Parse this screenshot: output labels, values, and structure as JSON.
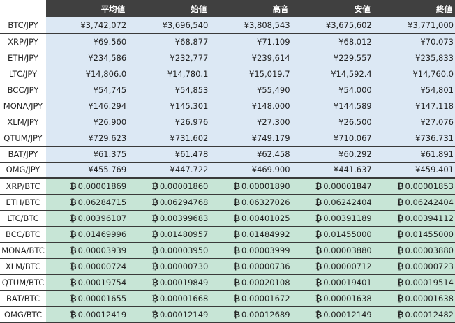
{
  "headers": [
    "",
    "平均値",
    "始値",
    "高音",
    "安値",
    "終値"
  ],
  "symbols": {
    "yen": "¥",
    "btc": "₿"
  },
  "colors": {
    "header_bg": "#404040",
    "jpy_row_bg": "#dce8f4",
    "btc_row_bg": "#c7e5d6",
    "border": "#3a3a3a"
  },
  "rows": [
    {
      "pair": "BTC/JPY",
      "group": "jpy",
      "values": [
        "3,742,072",
        "3,696,540",
        "3,808,543",
        "3,675,602",
        "3,771,000"
      ]
    },
    {
      "pair": "XRP/JPY",
      "group": "jpy",
      "values": [
        "69.560",
        "68.877",
        "71.109",
        "68.012",
        "70.073"
      ]
    },
    {
      "pair": "ETH/JPY",
      "group": "jpy",
      "values": [
        "234,586",
        "232,777",
        "239,614",
        "229,557",
        "235,833"
      ]
    },
    {
      "pair": "LTC/JPY",
      "group": "jpy",
      "values": [
        "14,806.0",
        "14,780.1",
        "15,019.7",
        "14,592.4",
        "14,760.0"
      ]
    },
    {
      "pair": "BCC/JPY",
      "group": "jpy",
      "values": [
        "54,745",
        "54,853",
        "55,490",
        "54,000",
        "54,801"
      ]
    },
    {
      "pair": "MONA/JPY",
      "group": "jpy",
      "values": [
        "146.294",
        "145.301",
        "148.000",
        "144.589",
        "147.118"
      ]
    },
    {
      "pair": "XLM/JPY",
      "group": "jpy",
      "values": [
        "26.900",
        "26.976",
        "27.300",
        "26.500",
        "27.076"
      ]
    },
    {
      "pair": "QTUM/JPY",
      "group": "jpy",
      "values": [
        "729.623",
        "731.602",
        "749.179",
        "710.067",
        "736.731"
      ]
    },
    {
      "pair": "BAT/JPY",
      "group": "jpy",
      "values": [
        "61.375",
        "61.478",
        "62.458",
        "60.292",
        "61.891"
      ]
    },
    {
      "pair": "OMG/JPY",
      "group": "jpy",
      "values": [
        "455.769",
        "447.722",
        "469.900",
        "441.637",
        "459.401"
      ]
    },
    {
      "pair": "XRP/BTC",
      "group": "btc",
      "values": [
        "0.00001869",
        "0.00001860",
        "0.00001890",
        "0.00001847",
        "0.00001853"
      ]
    },
    {
      "pair": "ETH/BTC",
      "group": "btc",
      "values": [
        "0.06284715",
        "0.06294768",
        "0.06327026",
        "0.06242404",
        "0.06242404"
      ]
    },
    {
      "pair": "LTC/BTC",
      "group": "btc",
      "values": [
        "0.00396107",
        "0.00399683",
        "0.00401025",
        "0.00391189",
        "0.00394112"
      ]
    },
    {
      "pair": "BCC/BTC",
      "group": "btc",
      "values": [
        "0.01469996",
        "0.01480957",
        "0.01484992",
        "0.01455000",
        "0.01455000"
      ]
    },
    {
      "pair": "MONA/BTC",
      "group": "btc",
      "values": [
        "0.00003939",
        "0.00003950",
        "0.00003999",
        "0.00003880",
        "0.00003880"
      ]
    },
    {
      "pair": "XLM/BTC",
      "group": "btc",
      "values": [
        "0.00000724",
        "0.00000730",
        "0.00000736",
        "0.00000712",
        "0.00000723"
      ]
    },
    {
      "pair": "QTUM/BTC",
      "group": "btc",
      "values": [
        "0.00019754",
        "0.00019849",
        "0.00020108",
        "0.00019401",
        "0.00019514"
      ]
    },
    {
      "pair": "BAT/BTC",
      "group": "btc",
      "values": [
        "0.00001655",
        "0.00001668",
        "0.00001672",
        "0.00001638",
        "0.00001638"
      ]
    },
    {
      "pair": "OMG/BTC",
      "group": "btc",
      "values": [
        "0.00012419",
        "0.00012149",
        "0.00012689",
        "0.00012149",
        "0.00012482"
      ]
    }
  ]
}
